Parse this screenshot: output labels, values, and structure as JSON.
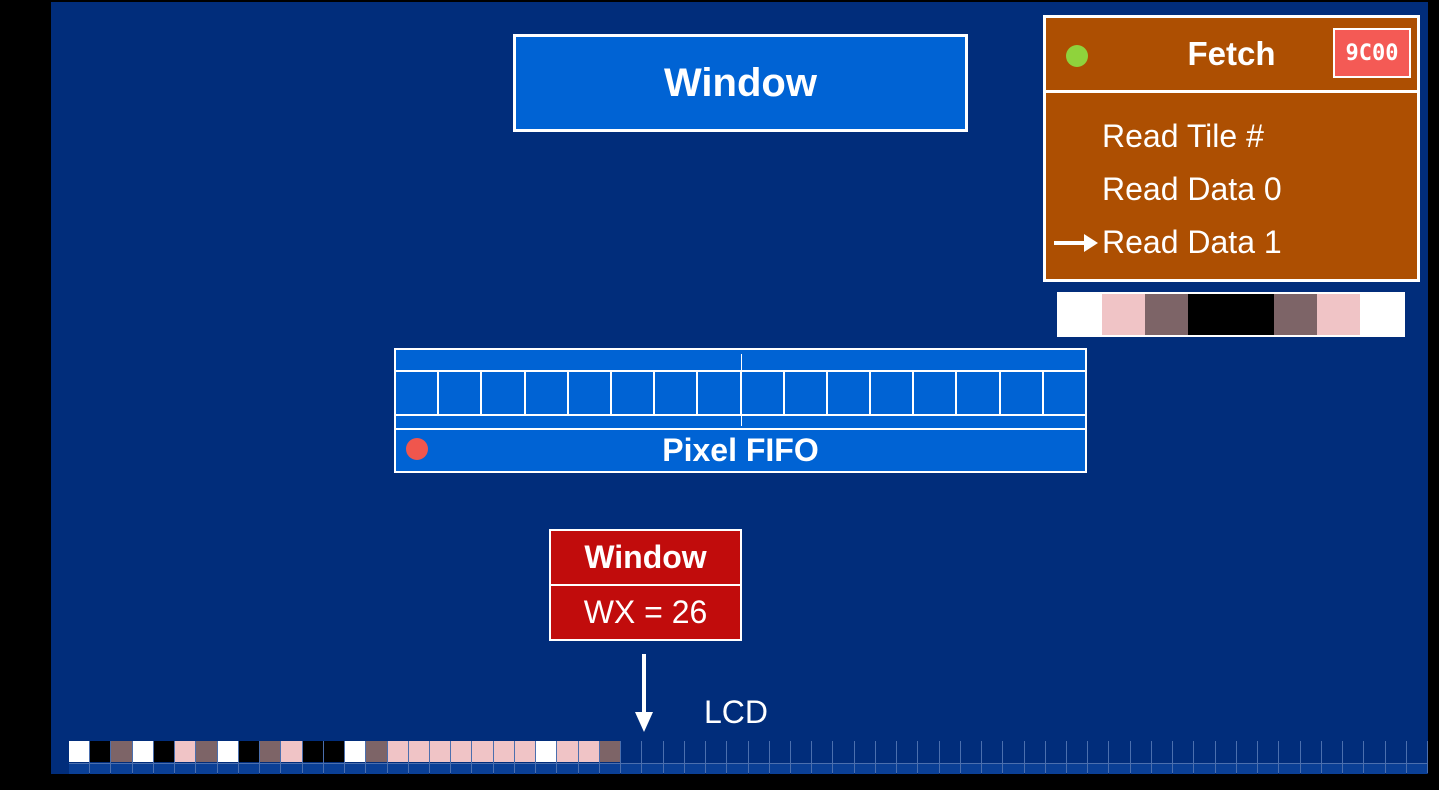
{
  "window_box": {
    "title": "Window"
  },
  "fetch": {
    "title": "Fetch",
    "address": "9C00",
    "steps": [
      "Read Tile #",
      "Read Data 0",
      "Read Data 1"
    ],
    "current_step": 2,
    "status_color": "#8fd33c"
  },
  "tile_pixels": [
    "white",
    "pink",
    "gray",
    "black",
    "black",
    "gray",
    "pink",
    "white"
  ],
  "pixel_palette": {
    "white": "#ffffff",
    "pink": "#f0c4c6",
    "gray": "#7d6467",
    "black": "#000000",
    "empty": "#012d7b"
  },
  "fifo": {
    "label": "Pixel FIFO",
    "slots": 16
  },
  "wx": {
    "title": "Window",
    "value": "WX = 26"
  },
  "lcd": {
    "label": "LCD",
    "pixels": [
      "white",
      "black",
      "gray",
      "white",
      "black",
      "pink",
      "gray",
      "white",
      "black",
      "gray",
      "pink",
      "black",
      "black",
      "white",
      "gray",
      "pink",
      "pink",
      "pink",
      "pink",
      "pink",
      "pink",
      "pink",
      "white",
      "pink",
      "pink",
      "gray"
    ],
    "total_cells": 64
  }
}
